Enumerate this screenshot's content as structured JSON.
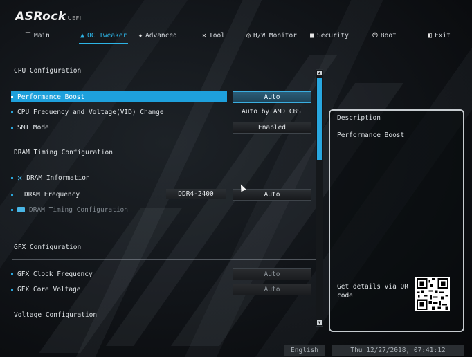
{
  "brand": {
    "name": "ASRock",
    "suffix": "UEFI"
  },
  "tabs": [
    {
      "label": "Main",
      "icon": "menu-icon"
    },
    {
      "label": "OC Tweaker",
      "icon": "rocket-icon"
    },
    {
      "label": "Advanced",
      "icon": "star-icon"
    },
    {
      "label": "Tool",
      "icon": "tools-icon"
    },
    {
      "label": "H/W Monitor",
      "icon": "monitor-icon"
    },
    {
      "label": "Security",
      "icon": "shield-icon"
    },
    {
      "label": "Boot",
      "icon": "power-icon"
    },
    {
      "label": "Exit",
      "icon": "exit-icon"
    }
  ],
  "active_tab": "OC Tweaker",
  "sections": {
    "cpu": "CPU Configuration",
    "dram": "DRAM Timing Configuration",
    "gfx": "GFX Configuration",
    "voltage": "Voltage Configuration"
  },
  "items": {
    "performance_boost": {
      "label": "Performance Boost",
      "value": "Auto"
    },
    "cpu_freq": {
      "label": "CPU Frequency and Voltage(VID) Change",
      "value": "Auto by AMD CBS"
    },
    "smt": {
      "label": "SMT Mode",
      "value": "Enabled"
    },
    "dram_info": {
      "label": "DRAM Information"
    },
    "dram_freq": {
      "label": "DRAM Frequency",
      "current": "DDR4-2400",
      "value": "Auto"
    },
    "dram_timing": {
      "label": "DRAM Timing Configuration"
    },
    "gfx_clock": {
      "label": "GFX Clock Frequency",
      "value": "Auto"
    },
    "gfx_core": {
      "label": "GFX Core Voltage",
      "value": "Auto"
    }
  },
  "description": {
    "title": "Description",
    "text": "Performance Boost",
    "qr_label": "Get details via QR code"
  },
  "footer": {
    "language": "English",
    "datetime": "Thu 12/27/2018, 07:41:12"
  },
  "colors": {
    "accent": "#1ea0dc",
    "background": "#0b0d10"
  }
}
